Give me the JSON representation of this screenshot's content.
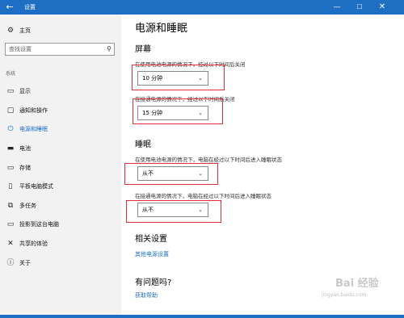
{
  "window": {
    "title": "设置",
    "back": "←",
    "minimize": "—",
    "maximize": "☐",
    "close": "✕"
  },
  "sidebar": {
    "home_label": "主页",
    "search_placeholder": "查找设置",
    "group_label": "系统",
    "items": [
      {
        "label": "显示",
        "icon": "display-icon"
      },
      {
        "label": "通知和操作",
        "icon": "notification-icon"
      },
      {
        "label": "电源和睡眠",
        "icon": "power-icon"
      },
      {
        "label": "电池",
        "icon": "battery-icon"
      },
      {
        "label": "存储",
        "icon": "storage-icon"
      },
      {
        "label": "平板电脑模式",
        "icon": "tablet-icon"
      },
      {
        "label": "多任务",
        "icon": "multitask-icon"
      },
      {
        "label": "投影到这台电脑",
        "icon": "project-icon"
      },
      {
        "label": "共享的体验",
        "icon": "share-icon"
      },
      {
        "label": "关于",
        "icon": "info-icon"
      }
    ]
  },
  "main": {
    "title": "电源和睡眠",
    "screen": {
      "heading": "屏幕",
      "battery_desc": "在使用电池电源的情况下，经过以下时间后关闭",
      "battery_value": "10 分钟",
      "plugged_desc": "在接通电源的情况下，经过以下时间后关闭",
      "plugged_value": "15 分钟"
    },
    "sleep": {
      "heading": "睡眠",
      "battery_desc": "在使用电池电源的情况下，电脑在经过以下时间后进入睡眠状态",
      "battery_value": "从不",
      "plugged_desc": "在接通电源的情况下，电脑在经过以下时间后进入睡眠状态",
      "plugged_value": "从不"
    },
    "related": {
      "heading": "相关设置",
      "link": "其他电源设置"
    },
    "help": {
      "heading": "有问题吗?",
      "link": "获取帮助"
    },
    "chevron": "⌄"
  },
  "watermark": {
    "brand": "Bai 经验",
    "sub": "jingyan.baidu.com"
  },
  "colors": {
    "accent": "#1e6fc4",
    "highlight": "#e0313a",
    "sidebar_bg": "#f2f2f2"
  }
}
